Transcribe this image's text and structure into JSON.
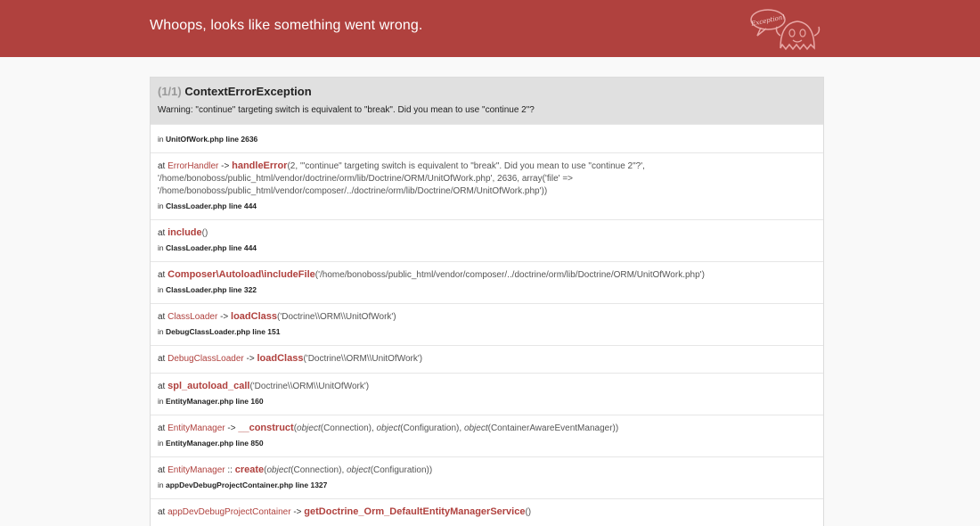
{
  "header": {
    "title": "Whoops, looks like something went wrong.",
    "logo_text": "Exception!"
  },
  "exception": {
    "count": "(1/1)",
    "class": "ContextErrorException",
    "message": "Warning: \"continue\" targeting switch is equivalent to \"break\". Did you mean to use \"continue 2\"?"
  },
  "trace": [
    {
      "location_prefix": "in",
      "location": "UnitOfWork.php line 2636"
    },
    {
      "at": "at",
      "class": "ErrorHandler",
      "op": "->",
      "function": "handleError",
      "args": "(2, '\"continue\" targeting switch is equivalent to \"break\". Did you mean to use \"continue 2\"?', '/home/bonoboss/public_html/vendor/doctrine/orm/lib/Doctrine/ORM/UnitOfWork.php', 2636, array('file' => '/home/bonoboss/public_html/vendor/composer/../doctrine/orm/lib/Doctrine/ORM/UnitOfWork.php'))",
      "location_prefix": "in",
      "location": "ClassLoader.php line 444"
    },
    {
      "at": "at",
      "function": "include",
      "args": "()",
      "location_prefix": "in",
      "location": "ClassLoader.php line 444"
    },
    {
      "at": "at",
      "function": "Composer\\Autoload\\includeFile",
      "args": "('/home/bonoboss/public_html/vendor/composer/../doctrine/orm/lib/Doctrine/ORM/UnitOfWork.php')",
      "location_prefix": "in",
      "location": "ClassLoader.php line 322"
    },
    {
      "at": "at",
      "class": "ClassLoader",
      "op": "->",
      "function": "loadClass",
      "args": "('Doctrine\\\\ORM\\\\UnitOfWork')",
      "location_prefix": "in",
      "location": "DebugClassLoader.php line 151"
    },
    {
      "at": "at",
      "class": "DebugClassLoader",
      "op": "->",
      "function": "loadClass",
      "args": "('Doctrine\\\\ORM\\\\UnitOfWork')"
    },
    {
      "at": "at",
      "function": "spl_autoload_call",
      "args": "('Doctrine\\\\ORM\\\\UnitOfWork')",
      "location_prefix": "in",
      "location": "EntityManager.php line 160"
    },
    {
      "at": "at",
      "class": "EntityManager",
      "op": "->",
      "function": "__construct",
      "args_parts": [
        "(",
        "object",
        "(Connection), ",
        "object",
        "(Configuration), ",
        "object",
        "(ContainerAwareEventManager))"
      ],
      "location_prefix": "in",
      "location": "EntityManager.php line 850"
    },
    {
      "at": "at",
      "class": "EntityManager",
      "op": "::",
      "function": "create",
      "args_parts": [
        "(",
        "object",
        "(Connection), ",
        "object",
        "(Configuration))"
      ],
      "location_prefix": "in",
      "location": "appDevDebugProjectContainer.php line 1327"
    },
    {
      "at": "at",
      "class": "appDevDebugProjectContainer",
      "op": "->",
      "function": "getDoctrine_Orm_DefaultEntityManagerService",
      "args": "()"
    }
  ]
}
